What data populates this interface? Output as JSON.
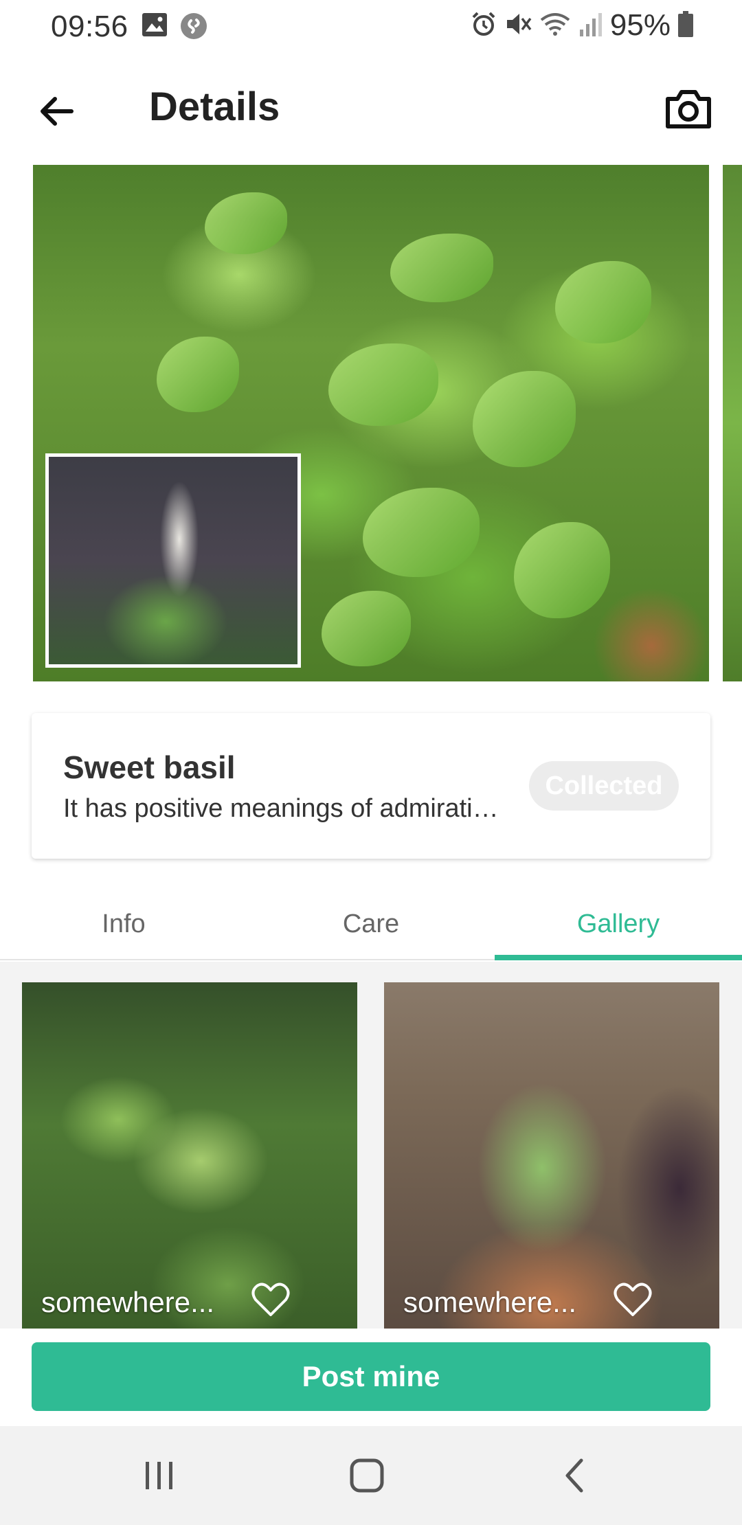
{
  "status_bar": {
    "time": "09:56",
    "battery": "95%",
    "left_icons": [
      "image-icon",
      "shazam-icon"
    ],
    "right_icons": [
      "alarm-icon",
      "mute-icon",
      "wifi-icon",
      "signal-icon",
      "battery-icon"
    ]
  },
  "app_bar": {
    "title": "Details",
    "back_icon": "arrow-left-icon",
    "camera_icon": "camera-icon"
  },
  "plant": {
    "name": "Sweet basil",
    "description": "It has positive meanings of admirati…",
    "collected_label": "Collected"
  },
  "tabs": [
    {
      "label": "Info",
      "active": false
    },
    {
      "label": "Care",
      "active": false
    },
    {
      "label": "Gallery",
      "active": true
    }
  ],
  "gallery": [
    {
      "caption": "somewhere...",
      "icon": "heart-outline-icon"
    },
    {
      "caption": "somewhere...",
      "icon": "heart-outline-icon"
    }
  ],
  "post_button": {
    "label": "Post mine"
  },
  "nav_bar": {
    "icons": [
      "recents-icon",
      "home-icon",
      "back-icon"
    ]
  },
  "colors": {
    "accent": "#2fbb94",
    "collected_bg": "#ececec"
  }
}
